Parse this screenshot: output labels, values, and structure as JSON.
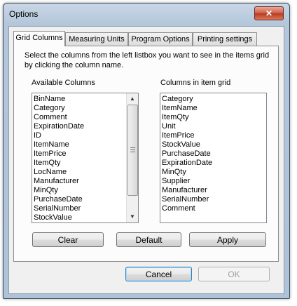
{
  "window": {
    "title": "Options",
    "close_glyph": "✕"
  },
  "tabs": [
    {
      "label": "Grid Columns",
      "active": true
    },
    {
      "label": "Measuring Units",
      "active": false
    },
    {
      "label": "Program Options",
      "active": false
    },
    {
      "label": "Printing settings",
      "active": false
    }
  ],
  "grid_columns": {
    "instructions": "Select the columns from the left listbox you want to see in the items grid by clicking the column name.",
    "available_label": "Available Columns",
    "selected_label": "Columns in item grid",
    "available": [
      "BinName",
      "Category",
      "Comment",
      "ExpirationDate",
      "ID",
      "ItemName",
      "ItemPrice",
      "ItemQty",
      "LocName",
      "Manufacturer",
      "MinQty",
      "PurchaseDate",
      "SerialNumber",
      "StockValue"
    ],
    "selected": [
      "Category",
      "ItemName",
      "ItemQty",
      "Unit",
      "ItemPrice",
      "StockValue",
      "PurchaseDate",
      "ExpirationDate",
      "MinQty",
      "Supplier",
      "Manufacturer",
      "SerialNumber",
      "Comment"
    ],
    "clear_label": "Clear",
    "default_label": "Default",
    "apply_label": "Apply"
  },
  "footer": {
    "cancel_label": "Cancel",
    "ok_label": "OK"
  }
}
